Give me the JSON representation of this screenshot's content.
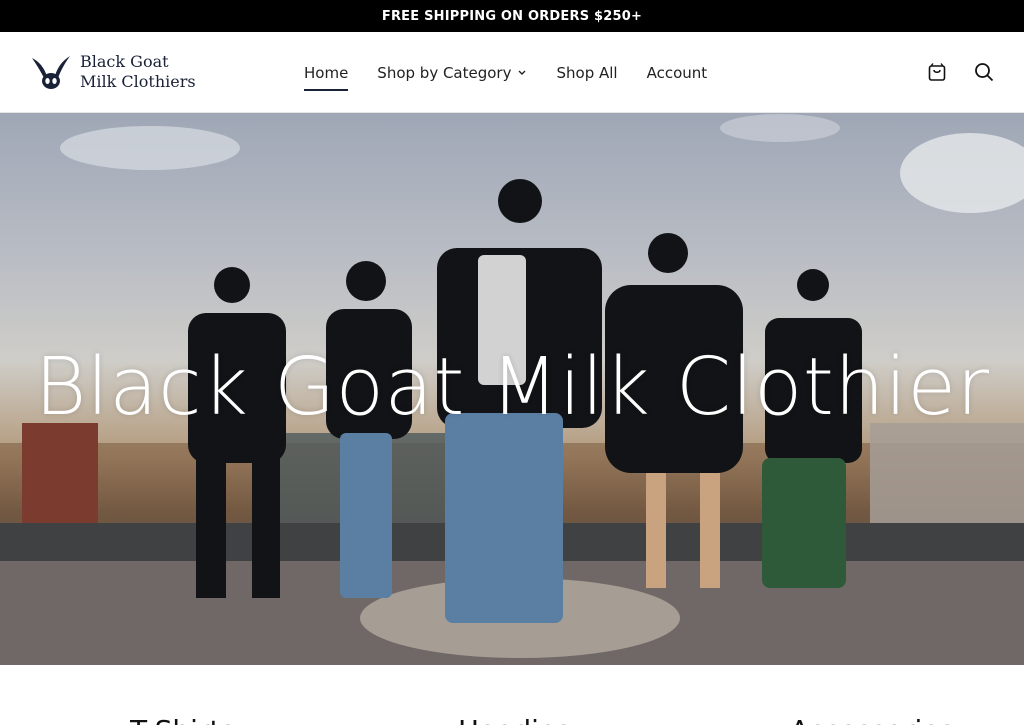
{
  "announcement": {
    "text": "FREE SHIPPING ON ORDERS $250+"
  },
  "brand": {
    "line1": "Black Goat",
    "line2": "Milk Clothiers",
    "color": "#1a2238"
  },
  "nav": {
    "items": [
      {
        "label": "Home",
        "active": true
      },
      {
        "label": "Shop by Category",
        "has_dropdown": true
      },
      {
        "label": "Shop All"
      },
      {
        "label": "Account"
      }
    ]
  },
  "header_icons": [
    "cart-icon",
    "search-icon"
  ],
  "hero": {
    "title": "Black Goat Milk Clothier"
  },
  "sections": {
    "peek_labels": [
      "T-Shirts",
      "Hoodies",
      "Accessories"
    ]
  }
}
